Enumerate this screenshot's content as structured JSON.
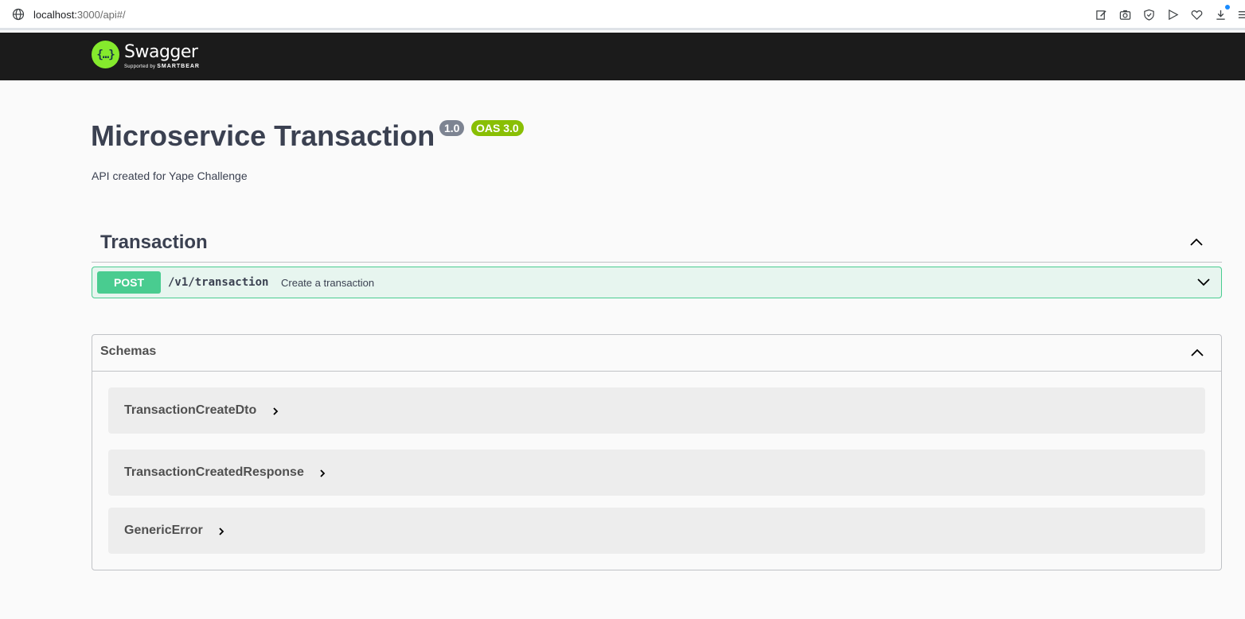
{
  "browser": {
    "url_host": "localhost:",
    "url_path": "3000/api#/",
    "icons": [
      "edit-icon",
      "camera-icon",
      "shield-icon",
      "send-icon",
      "heart-icon",
      "download-icon",
      "menu-icon"
    ]
  },
  "topbar": {
    "logo_name": "Swagger",
    "logo_sub_prefix": "Supported by",
    "logo_sub_brand": "SMARTBEAR",
    "logo_mark": "{…}"
  },
  "info": {
    "title": "Microservice Transaction",
    "version": "1.0",
    "oas": "OAS 3.0",
    "description": "API created for Yape Challenge"
  },
  "tag": {
    "name": "Transaction",
    "operations": [
      {
        "method": "POST",
        "path": "/v1/transaction",
        "summary": "Create a transaction"
      }
    ]
  },
  "schemas": {
    "title": "Schemas",
    "models": [
      {
        "name": "TransactionCreateDto"
      },
      {
        "name": "TransactionCreatedResponse"
      },
      {
        "name": "GenericError"
      }
    ]
  },
  "colors": {
    "post": "#49cc90",
    "topbar": "#1b1b1b",
    "logo": "#85ea2d",
    "version_badge": "#7d8492",
    "oas_badge": "#89bf04"
  }
}
